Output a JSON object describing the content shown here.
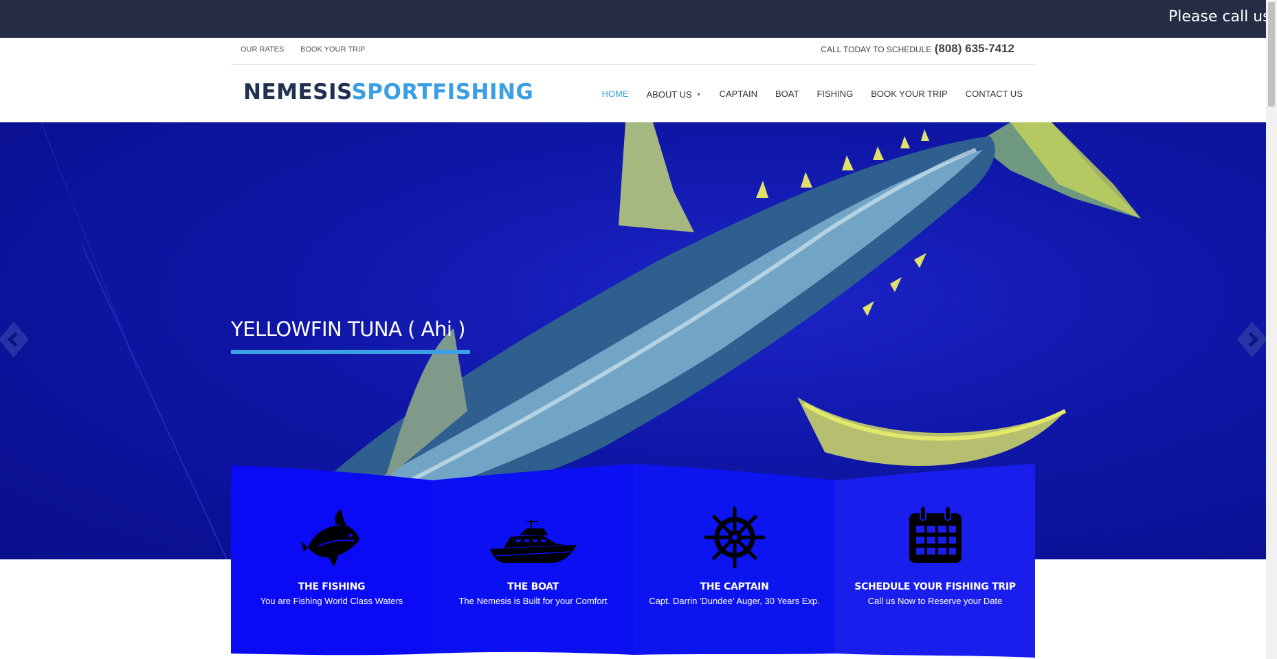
{
  "announcement": {
    "text": "Please call us d"
  },
  "utility": {
    "links": [
      "OUR RATES",
      "BOOK YOUR TRIP"
    ],
    "call_label": "CALL TODAY TO SCHEDULE",
    "phone": "(808) 635-7412"
  },
  "logo": {
    "part1": "NEMESIS",
    "part2": "SPORTFISHING"
  },
  "nav": {
    "items": [
      "HOME",
      "ABOUT US",
      "CAPTAIN",
      "BOAT",
      "FISHING",
      "BOOK YOUR TRIP",
      "CONTACT US"
    ],
    "active": "HOME"
  },
  "hero": {
    "title": "YELLOWFIN TUNA ( Ahi )"
  },
  "features": [
    {
      "title": "THE FISHING",
      "subtitle": "You are Fishing World Class Waters",
      "icon": "fish-icon"
    },
    {
      "title": "THE BOAT",
      "subtitle": "The Nemesis is Built for your Comfort",
      "icon": "boat-icon"
    },
    {
      "title": "THE CAPTAIN",
      "subtitle": "Capt. Darrin 'Dundee' Auger, 30 Years Exp.",
      "icon": "ship-wheel-icon"
    },
    {
      "title": "SCHEDULE YOUR FISHING TRIP",
      "subtitle": "Call us Now to Reserve your Date",
      "icon": "calendar-icon"
    }
  ],
  "colors": {
    "accent": "#3aa0e3",
    "dark_navy": "#252d45",
    "panel_blue": "#0a0af5"
  }
}
